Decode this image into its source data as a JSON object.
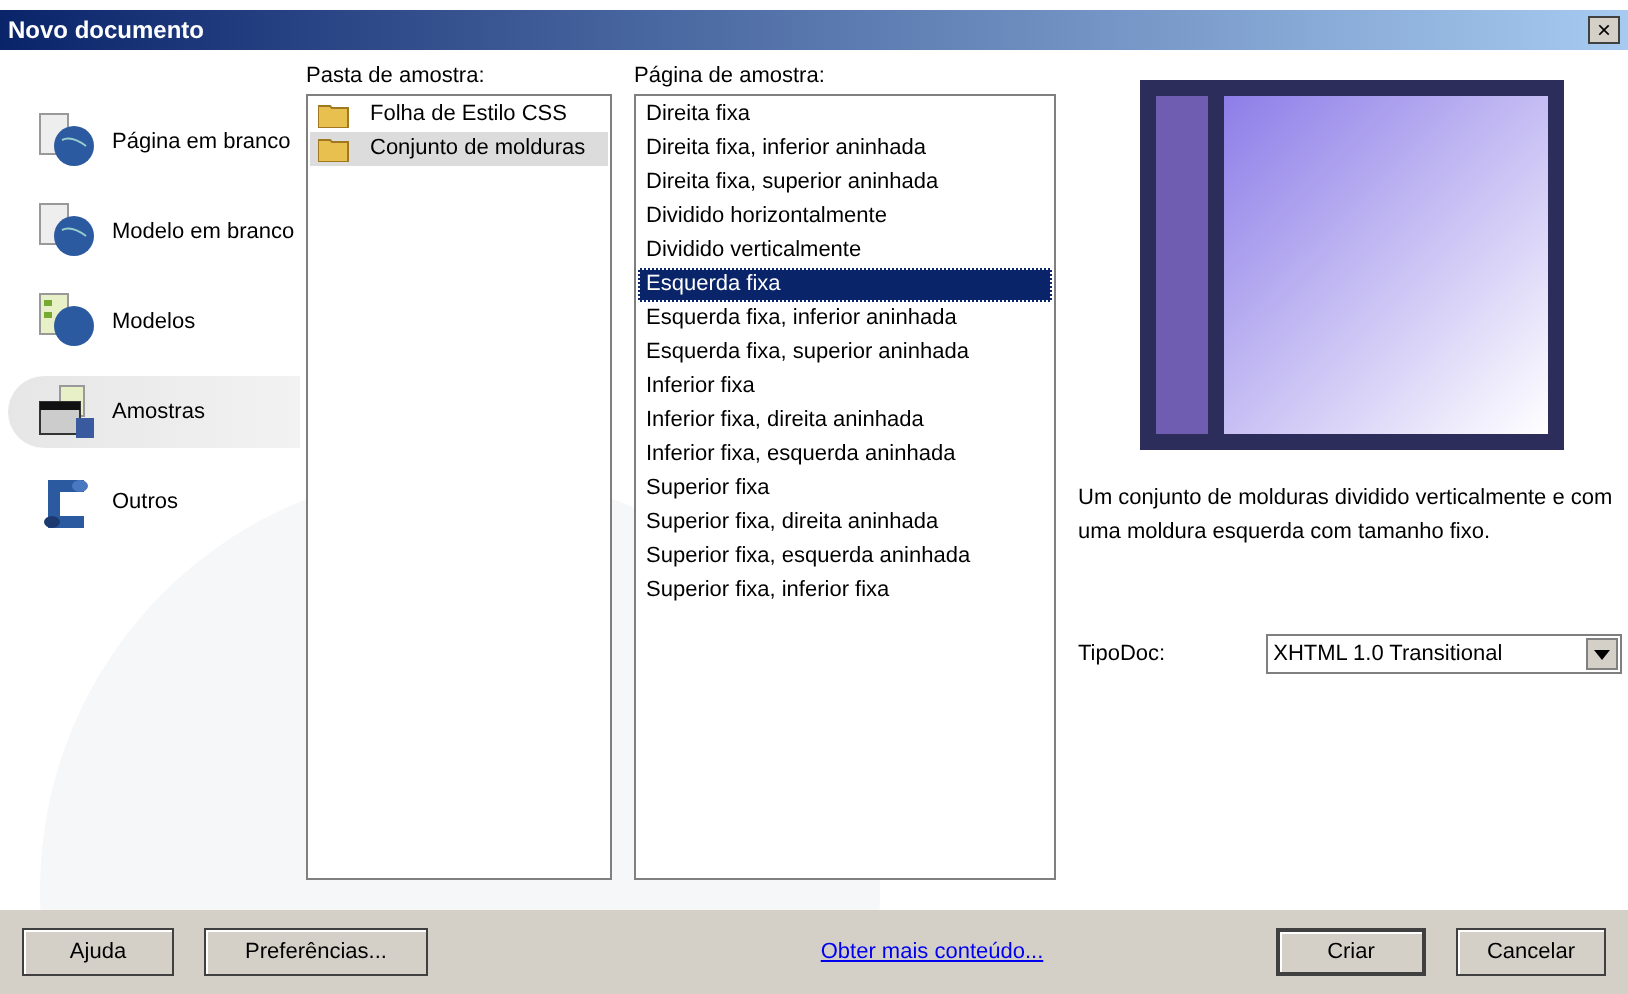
{
  "window": {
    "title": "Novo documento",
    "close": "×"
  },
  "categories": [
    {
      "label": "Página em branco",
      "kind": "page",
      "selected": false
    },
    {
      "label": "Modelo em branco",
      "kind": "page",
      "selected": false
    },
    {
      "label": "Modelos",
      "kind": "templates",
      "selected": false
    },
    {
      "label": "Amostras",
      "kind": "samples",
      "selected": true
    },
    {
      "label": "Outros",
      "kind": "scroll",
      "selected": false
    }
  ],
  "folders": {
    "label": "Pasta de amostra:",
    "items": [
      {
        "label": "Folha de Estilo CSS",
        "selected": false
      },
      {
        "label": "Conjunto de molduras",
        "selected": true
      }
    ]
  },
  "pages": {
    "label": "Página de amostra:",
    "items": [
      {
        "label": "Direita fixa",
        "selected": false
      },
      {
        "label": "Direita fixa, inferior aninhada",
        "selected": false
      },
      {
        "label": "Direita fixa, superior aninhada",
        "selected": false
      },
      {
        "label": "Dividido horizontalmente",
        "selected": false
      },
      {
        "label": "Dividido verticalmente",
        "selected": false
      },
      {
        "label": "Esquerda fixa",
        "selected": true
      },
      {
        "label": "Esquerda fixa, inferior aninhada",
        "selected": false
      },
      {
        "label": "Esquerda fixa, superior aninhada",
        "selected": false
      },
      {
        "label": "Inferior fixa",
        "selected": false
      },
      {
        "label": "Inferior fixa, direita aninhada",
        "selected": false
      },
      {
        "label": "Inferior fixa, esquerda aninhada",
        "selected": false
      },
      {
        "label": "Superior fixa",
        "selected": false
      },
      {
        "label": "Superior fixa, direita aninhada",
        "selected": false
      },
      {
        "label": "Superior fixa, esquerda aninhada",
        "selected": false
      },
      {
        "label": "Superior fixa, inferior fixa",
        "selected": false
      }
    ]
  },
  "description": "Um conjunto de molduras dividido verticalmente e com uma moldura esquerda com tamanho fixo.",
  "doctype": {
    "label": "TipoDoc:",
    "value": "XHTML 1.0 Transitional"
  },
  "footer": {
    "help": "Ajuda",
    "preferences": "Preferências...",
    "link": "Obter mais conteúdo...",
    "create": "Criar",
    "cancel": "Cancelar"
  }
}
